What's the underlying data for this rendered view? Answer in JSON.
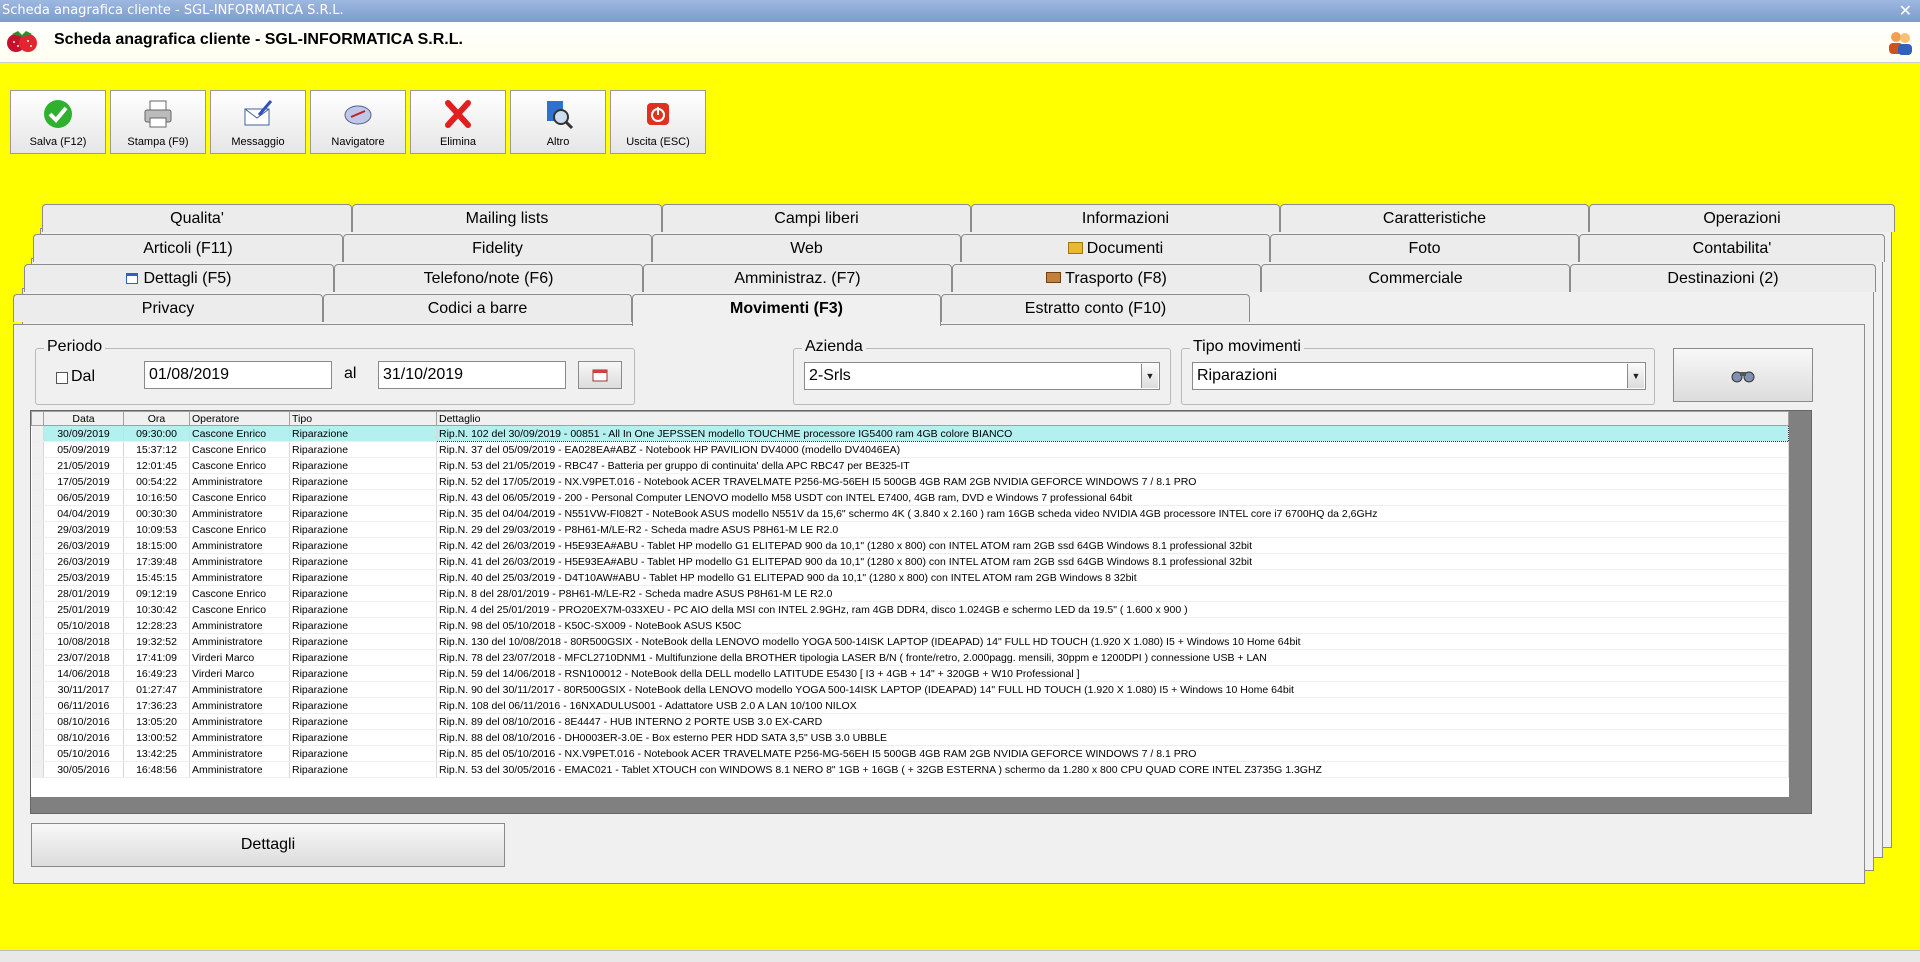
{
  "window": {
    "title": "Scheda anagrafica cliente - SGL-INFORMATICA S.R.L.",
    "close": "✕"
  },
  "header": {
    "title": "Scheda anagrafica cliente - SGL-INFORMATICA S.R.L."
  },
  "toolbar": {
    "salva": "Salva (F12)",
    "stampa": "Stampa (F9)",
    "messaggio": "Messaggio",
    "navigatore": "Navigatore",
    "elimina": "Elimina",
    "altro": "Altro",
    "uscita": "Uscita (ESC)"
  },
  "tabs": {
    "row1": [
      "Qualita'",
      "Mailing lists",
      "Campi liberi",
      "Informazioni",
      "Caratteristiche",
      "Operazioni"
    ],
    "row2": [
      "Articoli (F11)",
      "Fidelity",
      "Web",
      "Documenti",
      "Foto",
      "Contabilita'"
    ],
    "row3": [
      "Dettagli (F5)",
      "Telefono/note (F6)",
      "Amministraz. (F7)",
      "Trasporto (F8)",
      "Commerciale",
      "Destinazioni (2)"
    ],
    "row4": [
      "Privacy",
      "Codici a barre",
      "Movimenti (F3)",
      "Estratto conto (F10)"
    ]
  },
  "periodo": {
    "title": "Periodo",
    "dal_label": "Dal",
    "dal_value": "01/08/2019",
    "al_label": "al",
    "al_value": "31/10/2019"
  },
  "azienda": {
    "title": "Azienda",
    "value": "2-Srls"
  },
  "tipo_movimenti": {
    "title": "Tipo movimenti",
    "value": "Riparazioni"
  },
  "grid": {
    "columns": [
      "Data",
      "Ora",
      "Operatore",
      "Tipo",
      "Dettaglio"
    ],
    "rows": [
      [
        "30/09/2019",
        "09:30:00",
        "Cascone Enrico",
        "Riparazione",
        "Rip.N. 102 del 30/09/2019 - 00851 - All In One JEPSSEN modello TOUCHME processore IG5400 ram 4GB colore BIANCO"
      ],
      [
        "05/09/2019",
        "15:37:12",
        "Cascone Enrico",
        "Riparazione",
        "Rip.N. 37 del 05/09/2019 - EA028EA#ABZ - Notebook HP PAVILION DV4000 (modello DV4046EA)"
      ],
      [
        "21/05/2019",
        "12:01:45",
        "Cascone Enrico",
        "Riparazione",
        "Rip.N. 53 del 21/05/2019 - RBC47 - Batteria per gruppo di continuita' della APC RBC47 per BE325-IT"
      ],
      [
        "17/05/2019",
        "00:54:22",
        "Amministratore",
        "Riparazione",
        "Rip.N. 52 del 17/05/2019 - NX.V9PET.016 - Notebook ACER TRAVELMATE P256-MG-56EH I5 500GB 4GB RAM 2GB NVIDIA GEFORCE WINDOWS 7 / 8.1 PRO"
      ],
      [
        "06/05/2019",
        "10:16:50",
        "Cascone Enrico",
        "Riparazione",
        "Rip.N. 43 del 06/05/2019 - 200 - Personal Computer LENOVO modello M58 USDT con INTEL E7400, 4GB ram, DVD e Windows 7 professional 64bit"
      ],
      [
        "04/04/2019",
        "00:30:30",
        "Amministratore",
        "Riparazione",
        "Rip.N. 35 del 04/04/2019 - N551VW-FI082T - NoteBook ASUS modello N551V da 15,6\" schermo 4K ( 3.840 x 2.160 ) ram 16GB scheda video NVIDIA 4GB processore INTEL core i7 6700HQ da 2,6GHz"
      ],
      [
        "29/03/2019",
        "10:09:53",
        "Cascone Enrico",
        "Riparazione",
        "Rip.N. 29 del 29/03/2019 - P8H61-M/LE-R2 - Scheda madre ASUS P8H61-M LE R2.0"
      ],
      [
        "26/03/2019",
        "18:15:00",
        "Amministratore",
        "Riparazione",
        "Rip.N. 42 del 26/03/2019 - H5E93EA#ABU - Tablet HP modello G1 ELITEPAD 900 da 10,1\" (1280 x 800) con INTEL ATOM ram 2GB ssd 64GB Windows 8.1 professional 32bit"
      ],
      [
        "26/03/2019",
        "17:39:48",
        "Amministratore",
        "Riparazione",
        "Rip.N. 41 del 26/03/2019 - H5E93EA#ABU - Tablet HP modello G1 ELITEPAD 900 da 10,1\" (1280 x 800) con INTEL ATOM ram 2GB ssd 64GB Windows 8.1 professional 32bit"
      ],
      [
        "25/03/2019",
        "15:45:15",
        "Amministratore",
        "Riparazione",
        "Rip.N. 40 del 25/03/2019 - D4T10AW#ABU - Tablet HP modello G1 ELITEPAD 900 da 10,1\" (1280 x 800) con INTEL ATOM ram 2GB Windows 8 32bit"
      ],
      [
        "28/01/2019",
        "09:12:19",
        "Cascone Enrico",
        "Riparazione",
        "Rip.N. 8 del 28/01/2019 - P8H61-M/LE-R2 - Scheda madre ASUS P8H61-M LE R2.0"
      ],
      [
        "25/01/2019",
        "10:30:42",
        "Cascone Enrico",
        "Riparazione",
        "Rip.N. 4 del 25/01/2019 - PRO20EX7M-033XEU - PC AIO della MSI con INTEL 2.9GHz, ram 4GB DDR4, disco 1.024GB e schermo LED da 19.5\" ( 1.600 x 900 )"
      ],
      [
        "05/10/2018",
        "12:28:23",
        "Amministratore",
        "Riparazione",
        "Rip.N. 98 del 05/10/2018 - K50C-SX009 - NoteBook ASUS K50C"
      ],
      [
        "10/08/2018",
        "19:32:52",
        "Amministratore",
        "Riparazione",
        "Rip.N. 130 del 10/08/2018 - 80R500GSIX - NoteBook della LENOVO modello YOGA 500-14ISK LAPTOP (IDEAPAD) 14\" FULL HD TOUCH (1.920 X 1.080) I5 + Windows 10 Home 64bit"
      ],
      [
        "23/07/2018",
        "17:41:09",
        "Virderi Marco",
        "Riparazione",
        "Rip.N. 78 del 23/07/2018 - MFCL2710DNM1 - Multifunzione della BROTHER tipologia LASER B/N ( fronte/retro, 2.000pagg. mensili, 30ppm e 1200DPI ) connessione USB + LAN"
      ],
      [
        "14/06/2018",
        "16:49:23",
        "Virderi Marco",
        "Riparazione",
        "Rip.N. 59 del 14/06/2018 - RSN100012 - NoteBook della DELL modello LATITUDE E5430 [ I3 + 4GB + 14\" + 320GB + W10 Professional ]"
      ],
      [
        "30/11/2017",
        "01:27:47",
        "Amministratore",
        "Riparazione",
        "Rip.N. 90 del 30/11/2017 - 80R500GSIX - NoteBook della LENOVO modello YOGA 500-14ISK LAPTOP (IDEAPAD) 14\" FULL HD TOUCH (1.920 X 1.080) I5 + Windows 10 Home 64bit"
      ],
      [
        "06/11/2016",
        "17:36:23",
        "Amministratore",
        "Riparazione",
        "Rip.N. 108 del 06/11/2016 - 16NXADULUS001 - Adattatore USB 2.0 A LAN 10/100 NILOX"
      ],
      [
        "08/10/2016",
        "13:05:20",
        "Amministratore",
        "Riparazione",
        "Rip.N. 89 del 08/10/2016 - 8E4447 - HUB INTERNO 2 PORTE USB 3.0 EX-CARD"
      ],
      [
        "08/10/2016",
        "13:00:52",
        "Amministratore",
        "Riparazione",
        "Rip.N. 88 del 08/10/2016 - DH0003ER-3.0E - Box esterno PER HDD SATA 3,5\" USB 3.0 UBBLE"
      ],
      [
        "05/10/2016",
        "13:42:25",
        "Amministratore",
        "Riparazione",
        "Rip.N. 85 del 05/10/2016 - NX.V9PET.016 - Notebook ACER TRAVELMATE P256-MG-56EH I5 500GB 4GB RAM 2GB NVIDIA GEFORCE WINDOWS 7 / 8.1 PRO"
      ],
      [
        "30/05/2016",
        "16:48:56",
        "Amministratore",
        "Riparazione",
        "Rip.N. 53 del 30/05/2016 - EMAC021 - Tablet XTOUCH con WINDOWS 8.1 NERO 8\" 1GB + 16GB ( + 32GB ESTERNA ) schermo da 1.280 x 800 CPU QUAD CORE INTEL Z3735G 1.3GHZ"
      ]
    ]
  },
  "dettagli_button": "Dettagli",
  "colors": {
    "background": "#ffff00",
    "selected_row": "#b4f0f0"
  }
}
